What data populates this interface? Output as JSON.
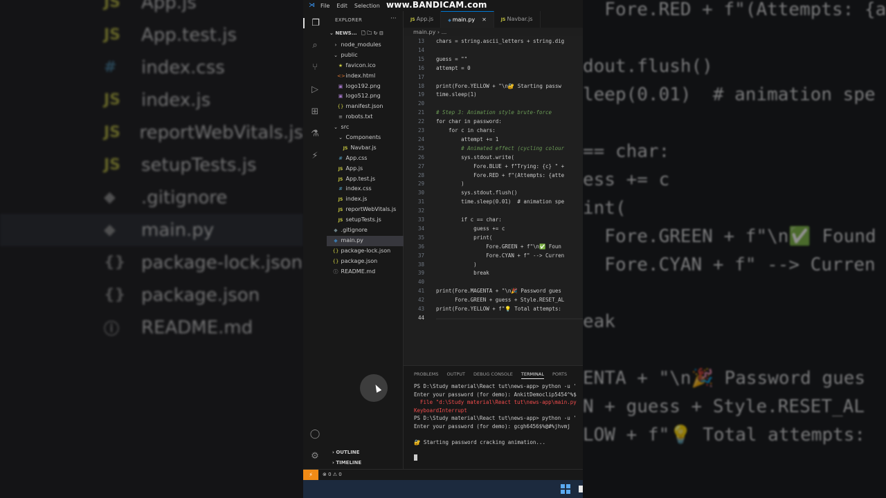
{
  "bg_left": {
    "rows": [
      {
        "icon": "JS",
        "name": "App.js"
      },
      {
        "icon": "JS",
        "name": "App.test.js"
      },
      {
        "icon": "#",
        "name": "index.css"
      },
      {
        "icon": "JS",
        "name": "index.js"
      },
      {
        "icon": "JS",
        "name": "reportWebVitals.js"
      },
      {
        "icon": "JS",
        "name": "setupTests.js"
      },
      {
        "icon": "◆",
        "name": ".gitignore"
      },
      {
        "icon": "◆",
        "name": "main.py"
      },
      {
        "icon": "{}",
        "name": "package-lock.json"
      },
      {
        "icon": "{}",
        "name": "package.json"
      },
      {
        "icon": "ⓘ",
        "name": "README.md"
      }
    ]
  },
  "bg_right": {
    "lines": [
      "  Fore.RED + f\"(Attempts: {atte",
      "",
      "dout.flush()",
      "leep(0.01)  # animation spe",
      "",
      "== char:",
      "ess += c",
      "int(",
      "  Fore.GREEN + f\"\\n✅ Found",
      "  Fore.CYAN + f\" --> Curren",
      "",
      "eak",
      "",
      "ENTA + \"\\n🎉 Password gues",
      "N + guess + Style.RESET_AL",
      "LOW + f\"💡 Total attempts:"
    ]
  },
  "titlebar": {
    "menu": [
      "File",
      "Edit",
      "Selection"
    ],
    "watermark": "www.BANDICAM.com"
  },
  "explorer": {
    "title": "EXPLORER",
    "more": "···",
    "project": "NEWS...",
    "items": [
      {
        "indent": 1,
        "glyph": "›",
        "name": "node_modules",
        "kind": "folder"
      },
      {
        "indent": 1,
        "glyph": "⌄",
        "name": "public",
        "kind": "folder"
      },
      {
        "indent": 2,
        "glyph": "★",
        "name": "favicon.ico",
        "kind": "ico"
      },
      {
        "indent": 2,
        "glyph": "<>",
        "name": "index.html",
        "kind": "html"
      },
      {
        "indent": 2,
        "glyph": "▣",
        "name": "logo192.png",
        "kind": "img"
      },
      {
        "indent": 2,
        "glyph": "▣",
        "name": "logo512.png",
        "kind": "img"
      },
      {
        "indent": 2,
        "glyph": "{}",
        "name": "manifest.json",
        "kind": "json"
      },
      {
        "indent": 2,
        "glyph": "≡",
        "name": "robots.txt",
        "kind": "txt"
      },
      {
        "indent": 1,
        "glyph": "⌄",
        "name": "src",
        "kind": "folder"
      },
      {
        "indent": 2,
        "glyph": "⌄",
        "name": "Components",
        "kind": "folder"
      },
      {
        "indent": 3,
        "glyph": "JS",
        "name": "Navbar.js",
        "kind": "js"
      },
      {
        "indent": 2,
        "glyph": "#",
        "name": "App.css",
        "kind": "css"
      },
      {
        "indent": 2,
        "glyph": "JS",
        "name": "App.js",
        "kind": "js"
      },
      {
        "indent": 2,
        "glyph": "JS",
        "name": "App.test.js",
        "kind": "js"
      },
      {
        "indent": 2,
        "glyph": "#",
        "name": "index.css",
        "kind": "css"
      },
      {
        "indent": 2,
        "glyph": "JS",
        "name": "index.js",
        "kind": "js"
      },
      {
        "indent": 2,
        "glyph": "JS",
        "name": "reportWebVitals.js",
        "kind": "js"
      },
      {
        "indent": 2,
        "glyph": "JS",
        "name": "setupTests.js",
        "kind": "js"
      },
      {
        "indent": 1,
        "glyph": "◆",
        "name": ".gitignore",
        "kind": "git"
      },
      {
        "indent": 1,
        "glyph": "◆",
        "name": "main.py",
        "kind": "py",
        "selected": true
      },
      {
        "indent": 1,
        "glyph": "{}",
        "name": "package-lock.json",
        "kind": "json"
      },
      {
        "indent": 1,
        "glyph": "{}",
        "name": "package.json",
        "kind": "json"
      },
      {
        "indent": 1,
        "glyph": "ⓘ",
        "name": "README.md",
        "kind": "txt"
      }
    ],
    "outline": "OUTLINE",
    "timeline": "TIMELINE"
  },
  "tabs": [
    {
      "label": "App.js",
      "active": false
    },
    {
      "label": "main.py",
      "active": true,
      "close": "✕"
    },
    {
      "label": "Navbar.js",
      "active": false
    }
  ],
  "breadcrumb": "main.py › ...",
  "code_lines": [
    {
      "n": "13",
      "t": "chars = string.ascii_letters + string.dig"
    },
    {
      "n": "14",
      "t": ""
    },
    {
      "n": "15",
      "t": "guess = \"\""
    },
    {
      "n": "16",
      "t": "attempt = 0"
    },
    {
      "n": "17",
      "t": ""
    },
    {
      "n": "18",
      "t": "print(Fore.YELLOW + \"\\n🔐 Starting passw"
    },
    {
      "n": "19",
      "t": "time.sleep(1)"
    },
    {
      "n": "20",
      "t": ""
    },
    {
      "n": "21",
      "t": "# Step 3: Animation style brute-force",
      "c": true
    },
    {
      "n": "22",
      "t": "for char in password:"
    },
    {
      "n": "23",
      "t": "    for c in chars:"
    },
    {
      "n": "24",
      "t": "        attempt += 1"
    },
    {
      "n": "25",
      "t": "        # Animated effect (cycling colour",
      "c": true
    },
    {
      "n": "26",
      "t": "        sys.stdout.write("
    },
    {
      "n": "27",
      "t": "            Fore.BLUE + f\"Trying: {c} \" +"
    },
    {
      "n": "28",
      "t": "            Fore.RED + f\"(Attempts: {atte"
    },
    {
      "n": "29",
      "t": "        )"
    },
    {
      "n": "30",
      "t": "        sys.stdout.flush()"
    },
    {
      "n": "31",
      "t": "        time.sleep(0.01)  # animation spe"
    },
    {
      "n": "32",
      "t": ""
    },
    {
      "n": "33",
      "t": "        if c == char:"
    },
    {
      "n": "34",
      "t": "            guess += c"
    },
    {
      "n": "35",
      "t": "            print("
    },
    {
      "n": "36",
      "t": "                Fore.GREEN + f\"\\n✅ Foun"
    },
    {
      "n": "37",
      "t": "                Fore.CYAN + f\" --> Curren"
    },
    {
      "n": "38",
      "t": "            )"
    },
    {
      "n": "39",
      "t": "            break"
    },
    {
      "n": "40",
      "t": ""
    },
    {
      "n": "41",
      "t": "print(Fore.MAGENTA + \"\\n🎉 Password gues"
    },
    {
      "n": "42",
      "t": "      Fore.GREEN + guess + Style.RESET_AL"
    },
    {
      "n": "43",
      "t": "print(Fore.YELLOW + f\"💡 Total attempts:"
    },
    {
      "n": "44",
      "t": "",
      "cur": true
    }
  ],
  "panel": {
    "tabs": [
      "PROBLEMS",
      "OUTPUT",
      "DEBUG CONSOLE",
      "TERMINAL",
      "PORTS"
    ],
    "active_tab": "TERMINAL",
    "terminal": [
      {
        "t": "PS D:\\Study material\\React tut\\news-app> python -u '"
      },
      {
        "t": "Enter your password (for demo): AnkitDemoclip5454^%$"
      },
      {
        "t": "  File \"d:\\Study material\\React tut\\news-app\\main.py",
        "err": true
      },
      {
        "t": "KeyboardInterrupt",
        "err": true
      },
      {
        "t": "PS D:\\Study material\\React tut\\news-app> python -u '"
      },
      {
        "t": "Enter your password (for demo): gcgh6456$%@#%jhvmj"
      },
      {
        "t": ""
      },
      {
        "t": "🔐 Starting password cracking animation..."
      },
      {
        "t": ""
      }
    ]
  },
  "status": {
    "problems": "⊗ 0 ⚠ 0",
    "remote": "⚡"
  }
}
